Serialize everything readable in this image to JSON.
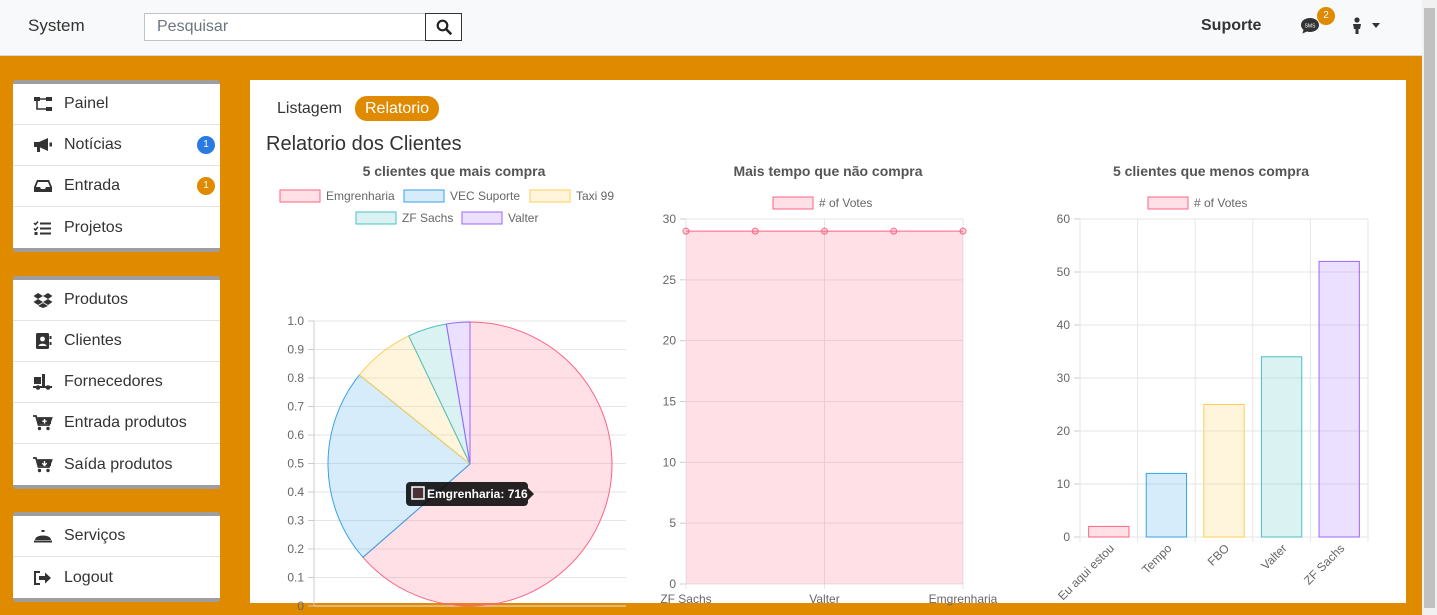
{
  "navbar": {
    "brand": "System",
    "search_placeholder": "Pesquisar",
    "support_label": "Suporte",
    "notification_count": "2"
  },
  "sidebar": {
    "groups": [
      {
        "items": [
          {
            "label": "Painel",
            "icon": "sitemap-icon"
          },
          {
            "label": "Notícias",
            "icon": "megaphone-icon",
            "badge": "1",
            "badge_color": "#2a7ae2"
          },
          {
            "label": "Entrada",
            "icon": "inbox-icon",
            "badge": "1",
            "badge_color": "#e08a00"
          },
          {
            "label": "Projetos",
            "icon": "tasks-icon"
          }
        ]
      },
      {
        "items": [
          {
            "label": "Produtos",
            "icon": "dropbox-icon"
          },
          {
            "label": "Clientes",
            "icon": "address-book-icon"
          },
          {
            "label": "Fornecedores",
            "icon": "truck-loading-icon"
          },
          {
            "label": "Entrada produtos",
            "icon": "cart-plus-icon"
          },
          {
            "label": "Saída produtos",
            "icon": "cart-arrow-icon"
          }
        ]
      },
      {
        "items": [
          {
            "label": "Serviços",
            "icon": "bell-service-icon"
          },
          {
            "label": "Logout",
            "icon": "sign-out-icon"
          }
        ]
      }
    ]
  },
  "tabs": {
    "list": "Listagem",
    "report": "Relatorio"
  },
  "page_title": "Relatorio dos Clientes",
  "colors": {
    "accent": "#e08a00",
    "badge_blue": "#2a7ae2"
  },
  "chart_data": [
    {
      "type": "pie",
      "title": "5 clientes que mais compra",
      "categories": [
        "Emgrenharia",
        "VEC Suporte",
        "Taxi 99",
        "ZF Sachs",
        "Valter"
      ],
      "values": [
        716,
        250,
        80,
        50,
        30
      ],
      "y_ticks": [
        "1.0",
        "0.9",
        "0.8",
        "0.7",
        "0.6",
        "0.5",
        "0.4",
        "0.3",
        "0.2",
        "0.1",
        "0"
      ],
      "ylim": [
        0,
        1
      ],
      "colors": [
        "#ff6384",
        "#36a2eb",
        "#ffce56",
        "#4bc0c0",
        "#9966ff"
      ],
      "legend": "top",
      "grid": true,
      "tooltip": "Emgrenharia: 716"
    },
    {
      "type": "area",
      "title": "Mais tempo que não compra",
      "series": [
        {
          "name": "# of Votes",
          "values": [
            29,
            29,
            29,
            29,
            29
          ]
        }
      ],
      "x_labels": [
        "ZF Sachs",
        "Valter",
        "Emgrenharia"
      ],
      "y_ticks": [
        "30",
        "25",
        "20",
        "15",
        "10",
        "5",
        "0"
      ],
      "ylim": [
        0,
        30
      ],
      "color": "#ff6384",
      "legend": "top",
      "grid": true
    },
    {
      "type": "bar",
      "title": "5 clientes que menos compra",
      "categories": [
        "Eu aqui estou",
        "Tempo",
        "FBO",
        "Valter",
        "ZF Sachs"
      ],
      "series": [
        {
          "name": "# of Votes",
          "values": [
            2,
            12,
            25,
            34,
            52
          ]
        }
      ],
      "y_ticks": [
        "60",
        "50",
        "40",
        "30",
        "20",
        "10",
        "0"
      ],
      "ylim": [
        0,
        60
      ],
      "colors": [
        "#ff6384",
        "#36a2eb",
        "#ffce56",
        "#4bc0c0",
        "#9966ff"
      ],
      "legend": "top",
      "grid": true
    }
  ]
}
